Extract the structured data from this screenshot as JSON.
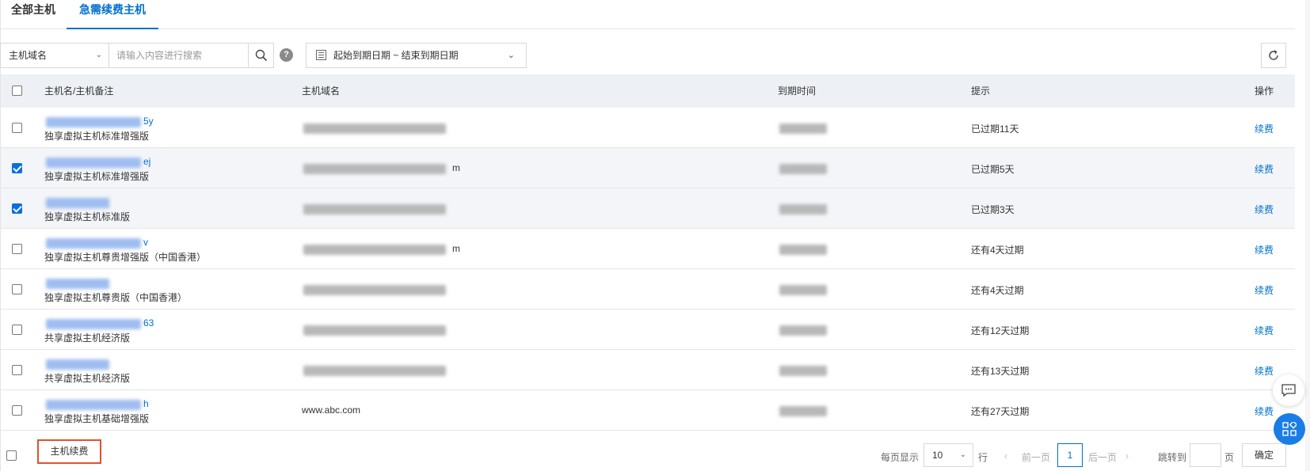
{
  "tabs": [
    {
      "label": "全部主机",
      "active": false
    },
    {
      "label": "急需续费主机",
      "active": true
    }
  ],
  "toolbar": {
    "field_select": "主机域名",
    "search_placeholder": "请输入内容进行搜索",
    "help": "?",
    "date_range": "起始到期日期 ~ 结束到期日期",
    "refresh_icon": "refresh-icon"
  },
  "table": {
    "headers": {
      "name": "主机名/主机备注",
      "domain": "主机域名",
      "expire": "到期时间",
      "tip": "提示",
      "op": "操作"
    },
    "rows": [
      {
        "name_suffix": "5y",
        "note": "独享虚拟主机标准增强版",
        "domain": "",
        "tip": "已过期11天",
        "op": "续费",
        "checked": false
      },
      {
        "name_suffix": "ej",
        "note": "独享虚拟主机标准增强版",
        "domain": "m",
        "tip": "已过期5天",
        "op": "续费",
        "checked": true
      },
      {
        "name_suffix": "",
        "note": "独享虚拟主机标准版",
        "domain": "",
        "tip": "已过期3天",
        "op": "续费",
        "checked": true
      },
      {
        "name_suffix": "v",
        "note": "独享虚拟主机尊贵增强版（中国香港）",
        "domain": "m",
        "tip": "还有4天过期",
        "op": "续费",
        "checked": false
      },
      {
        "name_suffix": "",
        "note": "独享虚拟主机尊贵版（中国香港）",
        "domain": "",
        "tip": "还有4天过期",
        "op": "续费",
        "checked": false
      },
      {
        "name_suffix": "63",
        "note": "共享虚拟主机经济版",
        "domain": "",
        "tip": "还有12天过期",
        "op": "续费",
        "checked": false
      },
      {
        "name_suffix": "",
        "note": "共享虚拟主机经济版",
        "domain": "",
        "tip": "还有13天过期",
        "op": "续费",
        "checked": false
      },
      {
        "name_suffix": "h",
        "note": "独享虚拟主机基础增强版",
        "domain": "www.abc.com",
        "tip": "还有27天过期",
        "op": "续费",
        "checked": false
      }
    ]
  },
  "footer": {
    "renew_button": "主机续费",
    "per_page_label": "每页显示",
    "per_page_value": "10",
    "per_page_unit": "行",
    "prev": "前一页",
    "current_page": "1",
    "next": "后一页",
    "jump_label": "跳转到",
    "jump_unit": "页",
    "confirm": "确定"
  },
  "colors": {
    "accent": "#0070cc",
    "highlight_border": "#e2502e",
    "header_bg": "#edf0f4"
  }
}
